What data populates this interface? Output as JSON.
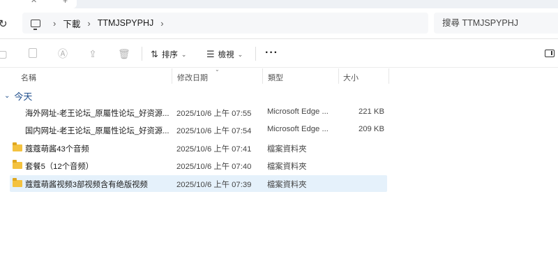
{
  "addressbar": {
    "crumbs": [
      "下載",
      "TTMJSPYPHJ"
    ],
    "search_placeholder": "搜尋 TTMJSPYPHJ"
  },
  "toolbar": {
    "sort_label": "排序",
    "view_label": "檢視",
    "more_label": "···"
  },
  "columns": {
    "name": "名稱",
    "date": "修改日期",
    "type": "類型",
    "size": "大小"
  },
  "group": {
    "label": "今天"
  },
  "files": [
    {
      "name": "海外网址-老王论坛_原屬性论坛_好资源...",
      "date": "2025/10/6 上午 07:55",
      "type": "Microsoft Edge ...",
      "size": "221 KB",
      "icon": "edge-icon"
    },
    {
      "name": "国内网址-老王论坛_原屬性论坛_好资源...",
      "date": "2025/10/6 上午 07:54",
      "type": "Microsoft Edge ...",
      "size": "209 KB",
      "icon": "edge-icon"
    },
    {
      "name": "蔻蔻萌酱43个音频",
      "date": "2025/10/6 上午 07:41",
      "type": "檔案資料夾",
      "size": "",
      "icon": "folder-icon"
    },
    {
      "name": "套餐5（12个音频）",
      "date": "2025/10/6 上午 07:40",
      "type": "檔案資料夾",
      "size": "",
      "icon": "folder-icon"
    },
    {
      "name": "蔻蔻萌酱视频3部视频含有绝版视频",
      "date": "2025/10/6 上午 07:39",
      "type": "檔案資料夾",
      "size": "",
      "icon": "folder-icon",
      "selected": true
    }
  ]
}
